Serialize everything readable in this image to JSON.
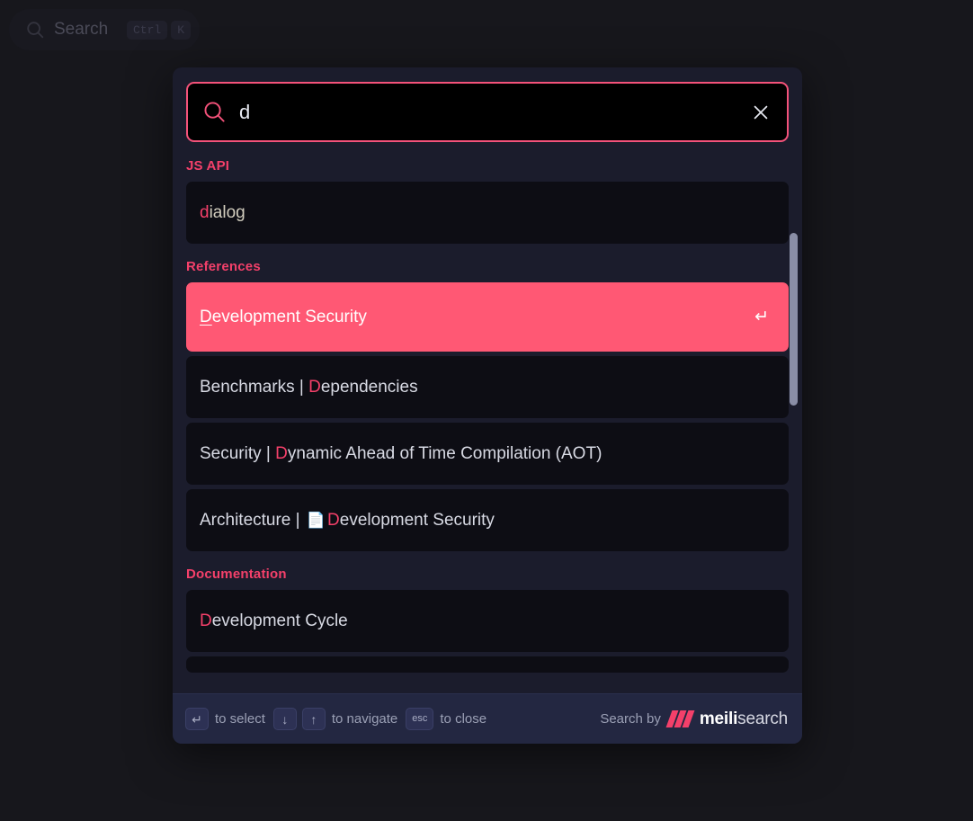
{
  "page_searchbar": {
    "icon": "search-icon",
    "label": "Search",
    "keys": [
      "Ctrl",
      "K"
    ]
  },
  "modal": {
    "search": {
      "icon": "search-icon",
      "value": "d",
      "placeholder": "Search",
      "clear_icon": "close-icon"
    },
    "sections": [
      {
        "title": "JS API",
        "results": [
          {
            "prefix": "",
            "highlight": "d",
            "tail": "ialog",
            "selected": false,
            "page_icon": false
          }
        ]
      },
      {
        "title": "References",
        "results": [
          {
            "prefix": "",
            "highlight": "D",
            "tail": "evelopment Security",
            "selected": true,
            "page_icon": false,
            "enter_glyph": "↵"
          },
          {
            "prefix": "Benchmarks | ",
            "highlight": "D",
            "tail": "ependencies",
            "selected": false,
            "page_icon": false
          },
          {
            "prefix": "Security | ",
            "highlight": "D",
            "tail": "ynamic Ahead of Time Compilation (AOT)",
            "selected": false,
            "page_icon": false
          },
          {
            "prefix": "Architecture | ",
            "highlight": "D",
            "tail": "evelopment Security",
            "selected": false,
            "page_icon": true,
            "page_icon_glyph": "📄"
          }
        ]
      },
      {
        "title": "Documentation",
        "results": [
          {
            "prefix": "",
            "highlight": "D",
            "tail": "evelopment Cycle",
            "selected": false,
            "page_icon": false
          }
        ]
      }
    ],
    "footer": {
      "hints": [
        {
          "keys": [
            "↵"
          ],
          "label": "to select"
        },
        {
          "keys": [
            "↓",
            "↑"
          ],
          "label": "to navigate"
        },
        {
          "keys": [
            "esc"
          ],
          "label": "to close"
        }
      ],
      "powered_by_label": "Search by",
      "brand_bold": "meili",
      "brand_light": "search"
    }
  },
  "colors": {
    "accent": "#f4406a",
    "selected_row": "#ff5874",
    "page_bg": "#17171c",
    "modal_bg": "#1b1c2c",
    "row_bg": "#0d0d14",
    "footer_bg": "#232741"
  }
}
